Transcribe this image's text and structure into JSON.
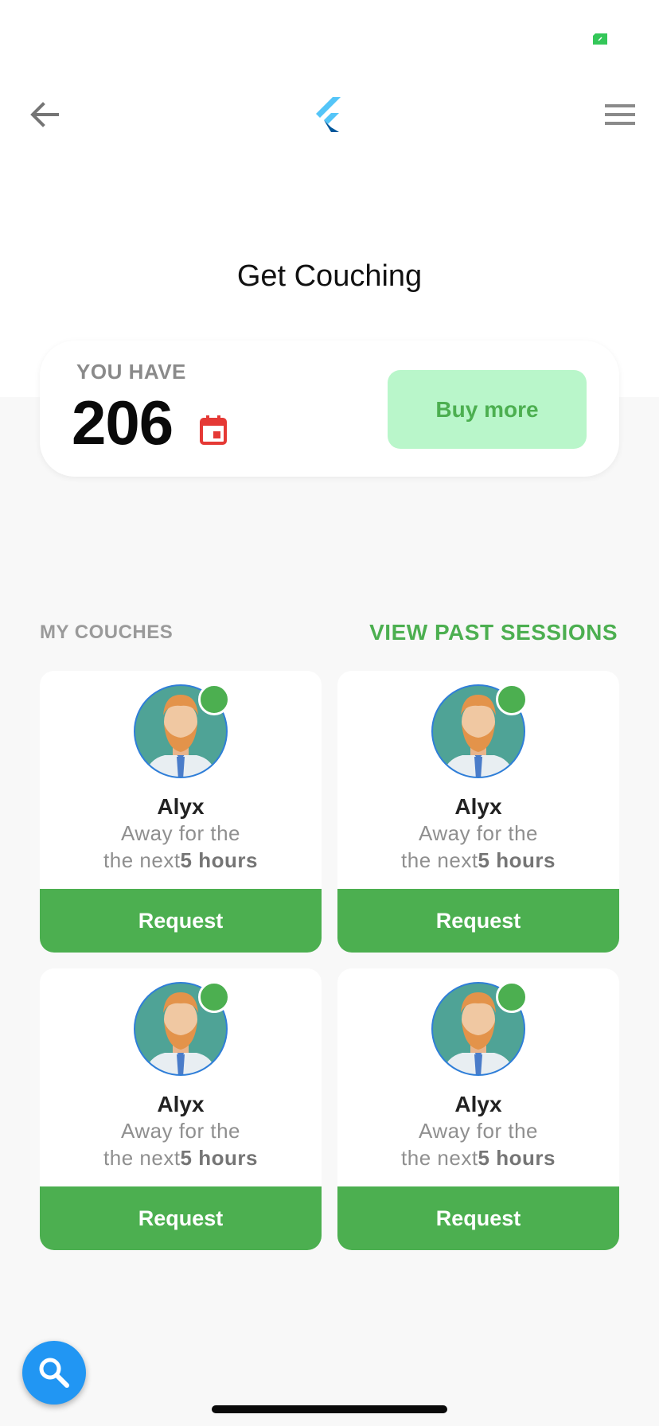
{
  "header": {
    "back_icon": "arrow-back-icon",
    "logo_icon": "flutter-logo-icon",
    "menu_icon": "hamburger-menu-icon",
    "status_icon": "battery-charging-icon"
  },
  "page": {
    "title": "Get Couching"
  },
  "balance": {
    "label": "YOU HAVE",
    "count": "206",
    "icon": "calendar-icon",
    "buy_label": "Buy more"
  },
  "coaches_section": {
    "title": "MY COUCHES",
    "view_past_label": "VIEW PAST SESSIONS",
    "cards": [
      {
        "name": "Alyx",
        "status_line1": "Away for the",
        "status_prefix": "the next",
        "status_hours": "5 hours",
        "button_label": "Request",
        "online": true
      },
      {
        "name": "Alyx",
        "status_line1": "Away for the",
        "status_prefix": "the next",
        "status_hours": "5 hours",
        "button_label": "Request",
        "online": true
      },
      {
        "name": "Alyx",
        "status_line1": "Away for the",
        "status_prefix": "the next",
        "status_hours": "5 hours",
        "button_label": "Request",
        "online": true
      },
      {
        "name": "Alyx",
        "status_line1": "Away for the",
        "status_prefix": "the next",
        "status_hours": "5 hours",
        "button_label": "Request",
        "online": true
      }
    ]
  },
  "fab": {
    "icon": "search-icon"
  },
  "colors": {
    "accent_green": "#4caf50",
    "buy_button_bg": "#b9f6ca",
    "fab_blue": "#2196f3",
    "calendar_red": "#e53935"
  }
}
